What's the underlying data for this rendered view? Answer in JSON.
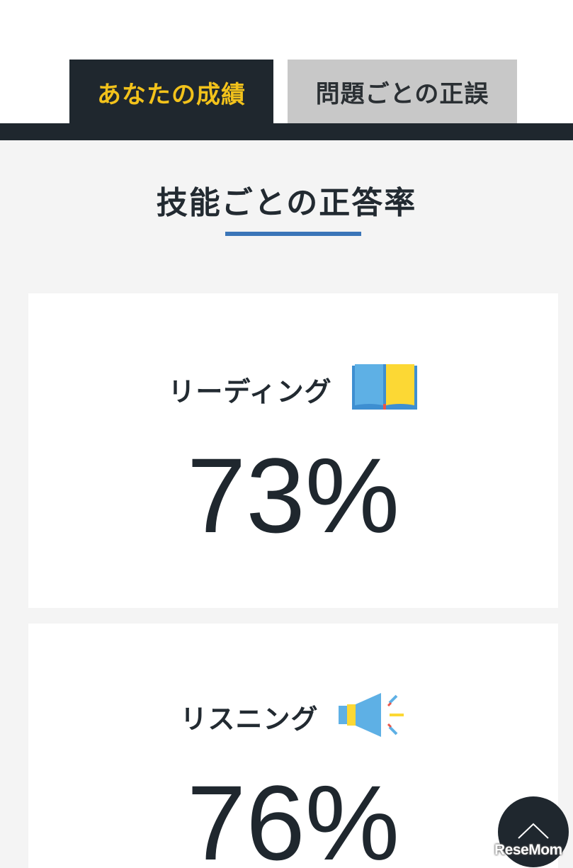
{
  "tabs": {
    "results_label": "あなたの成績",
    "answers_label": "問題ごとの正誤"
  },
  "section": {
    "title": "技能ごとの正答率"
  },
  "skills": [
    {
      "label": "リーディング",
      "icon": "open-book-icon",
      "score": "73%"
    },
    {
      "label": "リスニング",
      "icon": "megaphone-icon",
      "score": "76%"
    }
  ],
  "scroll_top": {
    "icon": "chevron-up-icon"
  },
  "watermark": "ReseMom",
  "colors": {
    "dark": "#1f272e",
    "accent_yellow": "#f2c21b",
    "inactive_tab": "#c8c8c8",
    "underline_blue": "#3a75b8",
    "icon_blue": "#5eb0e5",
    "icon_yellow": "#fcd834"
  }
}
